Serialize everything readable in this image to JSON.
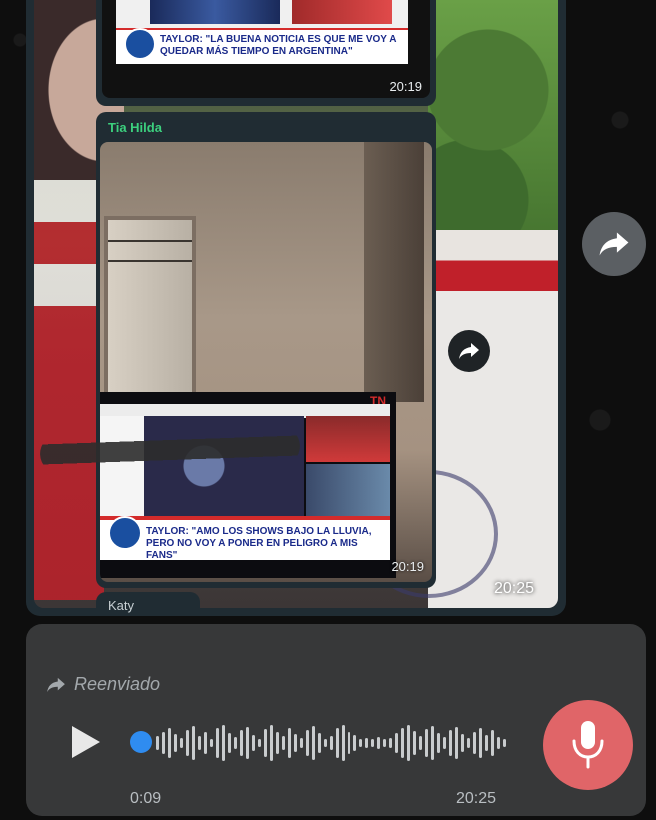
{
  "top_tv": {
    "headline": "TAYLOR: \"LA BUENA NOTICIA ES QUE ME VOY A QUEDAR MÁS TIEMPO EN ARGENTINA\"",
    "time": "20:19"
  },
  "hilda_message": {
    "sender": "Tia Hilda",
    "tv_headline": "TAYLOR: \"AMO LOS SHOWS BAJO LA LLUVIA, PERO NO VOY A PONER EN PELIGRO A MIS FANS\"",
    "tv_brand": "TN",
    "time": "20:19"
  },
  "outer_message": {
    "time": "20:25"
  },
  "next_sender": "Katy",
  "audio_message": {
    "forwarded_label": "Reenviado",
    "elapsed": "0:09",
    "timestamp": "20:25"
  },
  "icons": {
    "forward": "forward-arrow-icon",
    "play": "play-icon",
    "mic": "microphone-icon",
    "forwarded": "forwarded-arrow-icon"
  },
  "colors": {
    "mic_button": "#e06568",
    "progress_dot": "#2f8cf0",
    "sender_name": "#3cd07e",
    "bubble": "#202c33",
    "audio_card": "#373839"
  }
}
